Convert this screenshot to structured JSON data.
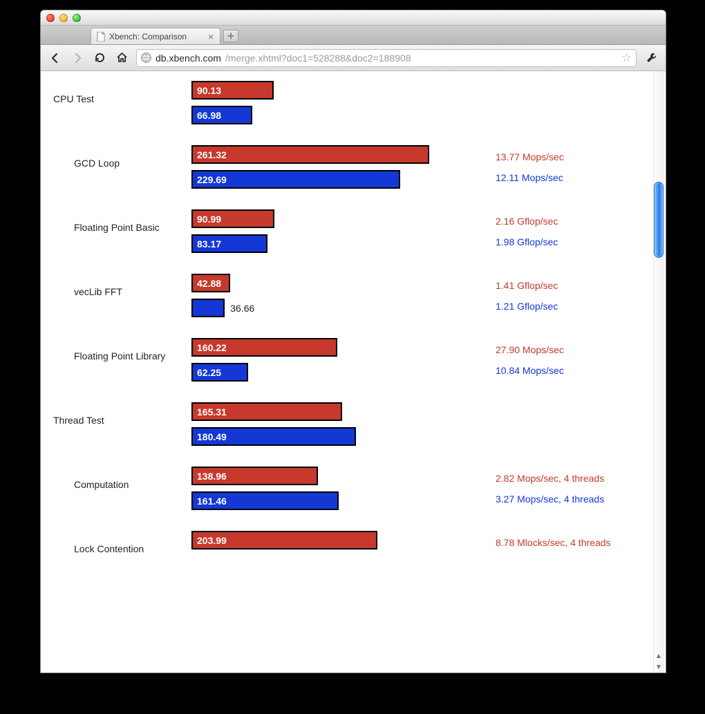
{
  "browser": {
    "tab_title": "Xbench: Comparison",
    "url_host": "db.xbench.com",
    "url_path": "/merge.xhtml?doc1=528288&doc2=188908"
  },
  "chart_data": {
    "type": "bar",
    "orientation": "horizontal",
    "series_colors": {
      "A": "#c6392c",
      "B": "#1338d6"
    },
    "max_value": 300,
    "rows": [
      {
        "label": "CPU Test",
        "indent": false,
        "a": {
          "value": 90.13,
          "metric": ""
        },
        "b": {
          "value": 66.98,
          "metric": ""
        }
      },
      {
        "label": "GCD Loop",
        "indent": true,
        "a": {
          "value": 261.32,
          "metric": "13.77 Mops/sec"
        },
        "b": {
          "value": 229.69,
          "metric": "12.11 Mops/sec"
        }
      },
      {
        "label": "Floating Point Basic",
        "indent": true,
        "a": {
          "value": 90.99,
          "metric": "2.16 Gflop/sec"
        },
        "b": {
          "value": 83.17,
          "metric": "1.98 Gflop/sec"
        }
      },
      {
        "label": "vecLib FFT",
        "indent": true,
        "a": {
          "value": 42.88,
          "metric": "1.41 Gflop/sec"
        },
        "b": {
          "value": 36.66,
          "metric": "1.21 Gflop/sec",
          "label_outside": true
        }
      },
      {
        "label": "Floating Point Library",
        "indent": true,
        "a": {
          "value": 160.22,
          "metric": "27.90 Mops/sec"
        },
        "b": {
          "value": 62.25,
          "metric": "10.84 Mops/sec"
        }
      },
      {
        "label": "Thread Test",
        "indent": false,
        "a": {
          "value": 165.31,
          "metric": ""
        },
        "b": {
          "value": 180.49,
          "metric": ""
        }
      },
      {
        "label": "Computation",
        "indent": true,
        "a": {
          "value": 138.96,
          "metric": "2.82 Mops/sec, 4 threads"
        },
        "b": {
          "value": 161.46,
          "metric": "3.27 Mops/sec, 4 threads"
        }
      },
      {
        "label": "Lock Contention",
        "indent": true,
        "partial": true,
        "a": {
          "value": 203.99,
          "metric": "8.78 Mlocks/sec, 4 threads"
        },
        "b": {
          "value": null,
          "metric": ""
        }
      }
    ]
  }
}
